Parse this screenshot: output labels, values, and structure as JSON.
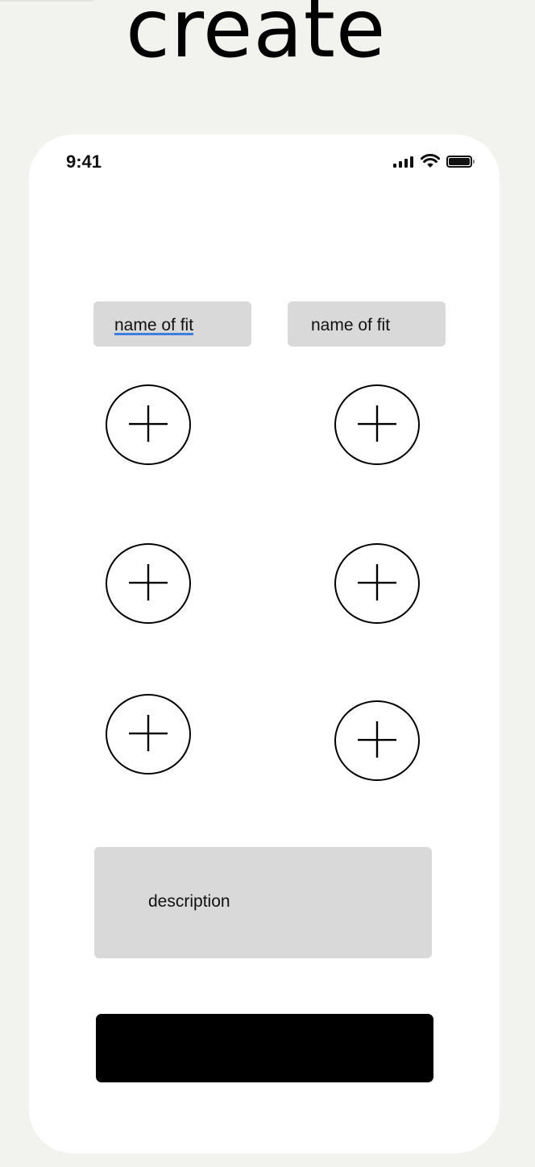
{
  "page": {
    "title": "create"
  },
  "status_bar": {
    "time": "9:41",
    "icons": [
      "signal-icon",
      "wifi-icon",
      "battery-icon"
    ]
  },
  "form": {
    "name_fields": [
      {
        "value": "name of fit",
        "spellcheck_underline": true
      },
      {
        "value": "name of fit",
        "spellcheck_underline": false
      }
    ],
    "add_item_buttons": [
      {
        "icon": "plus-circle-icon"
      },
      {
        "icon": "plus-circle-icon"
      },
      {
        "icon": "plus-circle-icon"
      },
      {
        "icon": "plus-circle-icon"
      },
      {
        "icon": "plus-circle-icon"
      },
      {
        "icon": "plus-circle-icon"
      }
    ],
    "description_placeholder": "description",
    "submit_label": ""
  },
  "colors": {
    "background": "#f2f2ee",
    "phone": "#ffffff",
    "field": "#d9d9d9",
    "button": "#000000",
    "spellcheck": "#3d7ee0"
  }
}
